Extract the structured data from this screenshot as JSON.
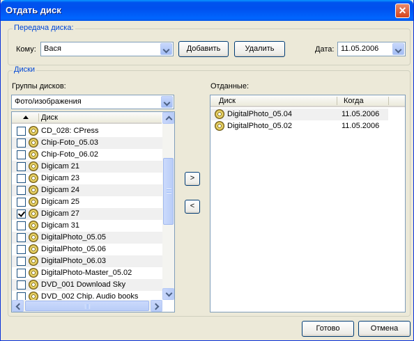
{
  "window": {
    "title": "Отдать диск",
    "close_glyph": "✕"
  },
  "transfer": {
    "legend": "Передача диска:",
    "to_label": "Кому:",
    "to_value": "Вася",
    "add_button": "Добавить",
    "remove_button": "Удалить",
    "date_label": "Дата:",
    "date_value": "11.05.2006"
  },
  "disks": {
    "legend": "Диски",
    "groups_label": "Группы дисков:",
    "group_value": "Фото/изображения",
    "column_disk": "Диск",
    "items": [
      {
        "name": "CD_028: CPress",
        "checked": false
      },
      {
        "name": "Chip-Foto_05.03",
        "checked": false
      },
      {
        "name": "Chip-Foto_06.02",
        "checked": false
      },
      {
        "name": "Digicam 21",
        "checked": false
      },
      {
        "name": "Digicam 23",
        "checked": false
      },
      {
        "name": "Digicam 24",
        "checked": false
      },
      {
        "name": "Digicam 25",
        "checked": false
      },
      {
        "name": "Digicam 27",
        "checked": true
      },
      {
        "name": "Digicam 31",
        "checked": false
      },
      {
        "name": "DigitalPhoto_05.05",
        "checked": false
      },
      {
        "name": "DigitalPhoto_05.06",
        "checked": false
      },
      {
        "name": "DigitalPhoto_06.03",
        "checked": false
      },
      {
        "name": "DigitalPhoto-Master_05.02",
        "checked": false
      },
      {
        "name": "DVD_001 Download Sky",
        "checked": false
      },
      {
        "name": "DVD_002 Chip. Audio books",
        "checked": false
      }
    ]
  },
  "move": {
    "right": ">",
    "left": "<"
  },
  "given": {
    "label": "Отданные:",
    "column_disk": "Диск",
    "column_when": "Когда",
    "items": [
      {
        "name": "DigitalPhoto_05.04",
        "date": "11.05.2006"
      },
      {
        "name": "DigitalPhoto_05.02",
        "date": "11.05.2006"
      }
    ]
  },
  "footer": {
    "ok_button": "Готово",
    "cancel_button": "Отмена"
  }
}
